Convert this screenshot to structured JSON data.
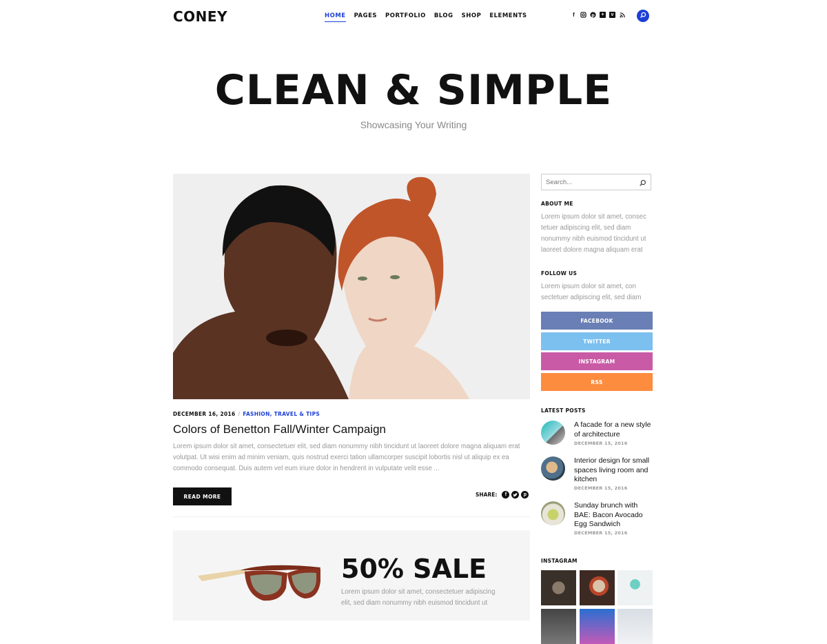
{
  "header": {
    "logo": "CONEY",
    "nav": [
      {
        "label": "HOME",
        "active": true
      },
      {
        "label": "PAGES",
        "active": false
      },
      {
        "label": "PORTFOLIO",
        "active": false
      },
      {
        "label": "BLOG",
        "active": false
      },
      {
        "label": "SHOP",
        "active": false
      },
      {
        "label": "ELEMENTS",
        "active": false
      }
    ],
    "social_icons": [
      "facebook-icon",
      "instagram-icon",
      "pinterest-icon",
      "plus-icon",
      "vimeo-icon",
      "rss-icon"
    ],
    "search_icon": "search-icon"
  },
  "hero": {
    "title": "CLEAN & SIMPLE",
    "subtitle": "Showcasing Your Writing"
  },
  "post": {
    "date": "DECEMBER 16, 2016",
    "separator": "/",
    "categories": "FASHION, TRAVEL & TIPS",
    "title": "Colors of Benetton Fall/Winter Campaign",
    "excerpt": "Lorem ipsum dolor sit amet, consectetuer elit, sed diam nonummy nibh tincidunt ut laoreet dolore magna aliquam erat volutpat. Ut wisi enim ad minim veniam, quis nostrud exerci tation ullamcorper suscipit lobortis nisl ut aliquip ex ea commodo consequat. Duis autem vel eum iriure dolor in hendrerit in vulputate velit esse ...",
    "read_more": "READ MORE",
    "share_label": "SHARE:"
  },
  "sale": {
    "title": "50% SALE",
    "text": "Lorem ipsum dolor sit amet, consectetuer adipiscing elit, sed diam nonummy nibh euismod tincidunt ut"
  },
  "sidebar": {
    "search_placeholder": "Search...",
    "about_title": "ABOUT ME",
    "about_text": "Lorem ipsum dolor sit amet, consec tetuer adipiscing elit, sed diam nonummy nibh euismod tincidunt ut laoreet dolore magna aliquam erat",
    "follow_title": "FOLLOW US",
    "follow_text": "Lorem ipsum dolor sit amet, con sectetuer adipiscing elit, sed diam",
    "buttons": [
      {
        "label": "FACEBOOK",
        "color": "#6a7fb5"
      },
      {
        "label": "TWITTER",
        "color": "#7cc0ef"
      },
      {
        "label": "INSTAGRAM",
        "color": "#c95ba6"
      },
      {
        "label": "RSS",
        "color": "#fd8c3f"
      }
    ],
    "latest_title": "LATEST POSTS",
    "latest_posts": [
      {
        "title": "A facade for a new style of architecture",
        "date": "DECEMBER 15, 2016"
      },
      {
        "title": "Interior design for small spaces living room and kitchen",
        "date": "DECEMBER 15, 2016"
      },
      {
        "title": "Sunday brunch with BAE: Bacon Avocado Egg Sandwich",
        "date": "DECEMBER 15, 2016"
      }
    ],
    "instagram_title": "INSTAGRAM"
  },
  "colors": {
    "accent": "#1d3fd6",
    "text_dark": "#111111",
    "text_muted": "#999999"
  }
}
